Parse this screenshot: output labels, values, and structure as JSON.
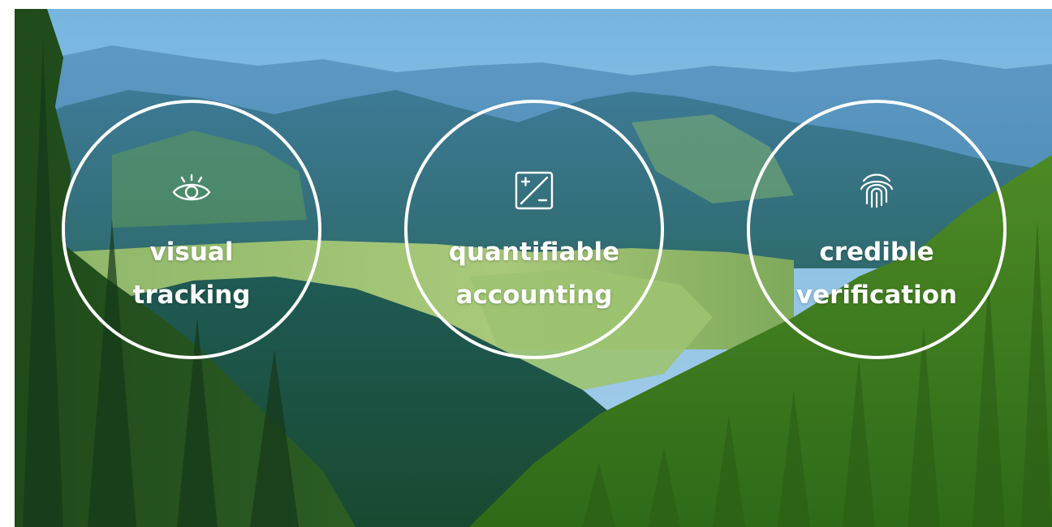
{
  "features": [
    {
      "icon": "eye-icon",
      "line1": "visual",
      "line2": "tracking"
    },
    {
      "icon": "plus-minus-icon",
      "line1": "quantifiable",
      "line2": "accounting"
    },
    {
      "icon": "fingerprint-icon",
      "line1": "credible",
      "line2": "verification"
    }
  ],
  "colors": {
    "sky": "#6fb0dc",
    "mountains": "#3f86b1",
    "forest": "#3a7a1f",
    "ring": "#ffffff",
    "text": "#ffffff"
  }
}
